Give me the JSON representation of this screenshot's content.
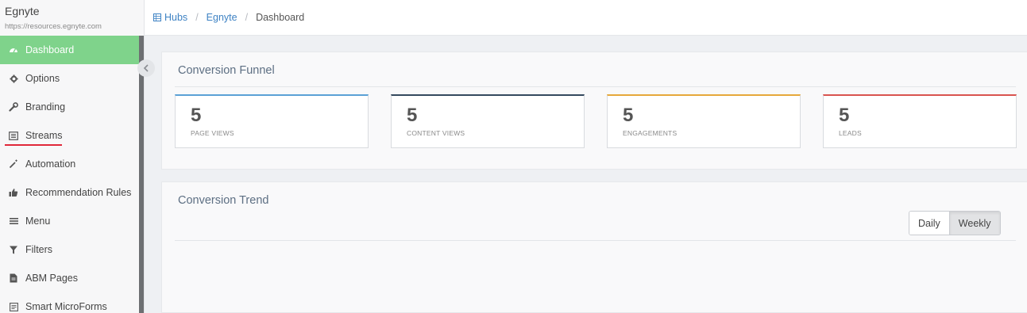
{
  "brand": {
    "name": "Egnyte",
    "url": "https://resources.egnyte.com"
  },
  "sidebar": {
    "items": [
      {
        "label": "Dashboard",
        "icon": "dashboard-icon",
        "active": true
      },
      {
        "label": "Options",
        "icon": "gear-icon"
      },
      {
        "label": "Branding",
        "icon": "wrench-icon"
      },
      {
        "label": "Streams",
        "icon": "list-alt-icon"
      },
      {
        "label": "Automation",
        "icon": "magic-wand-icon"
      },
      {
        "label": "Recommendation Rules",
        "icon": "thumbs-up-icon"
      },
      {
        "label": "Menu",
        "icon": "bars-icon"
      },
      {
        "label": "Filters",
        "icon": "filter-icon"
      },
      {
        "label": "ABM Pages",
        "icon": "document-icon"
      },
      {
        "label": "Smart MicroForms",
        "icon": "form-icon"
      }
    ]
  },
  "breadcrumb": {
    "root": "Hubs",
    "hub": "Egnyte",
    "current": "Dashboard"
  },
  "funnel": {
    "title": "Conversion Funnel",
    "cards": [
      {
        "value": "5",
        "label": "PAGE VIEWS",
        "color": "#5aa1d6"
      },
      {
        "value": "5",
        "label": "CONTENT VIEWS",
        "color": "#34495e"
      },
      {
        "value": "5",
        "label": "ENGAGEMENTS",
        "color": "#e6a83a"
      },
      {
        "value": "5",
        "label": "LEADS",
        "color": "#d9534f"
      }
    ]
  },
  "trend": {
    "title": "Conversion Trend",
    "toggle": {
      "daily": "Daily",
      "weekly": "Weekly",
      "selected": "Weekly"
    }
  },
  "colors": {
    "accent": "#7fd38b",
    "link": "#3f83c4",
    "annotation": "#e0283a"
  }
}
